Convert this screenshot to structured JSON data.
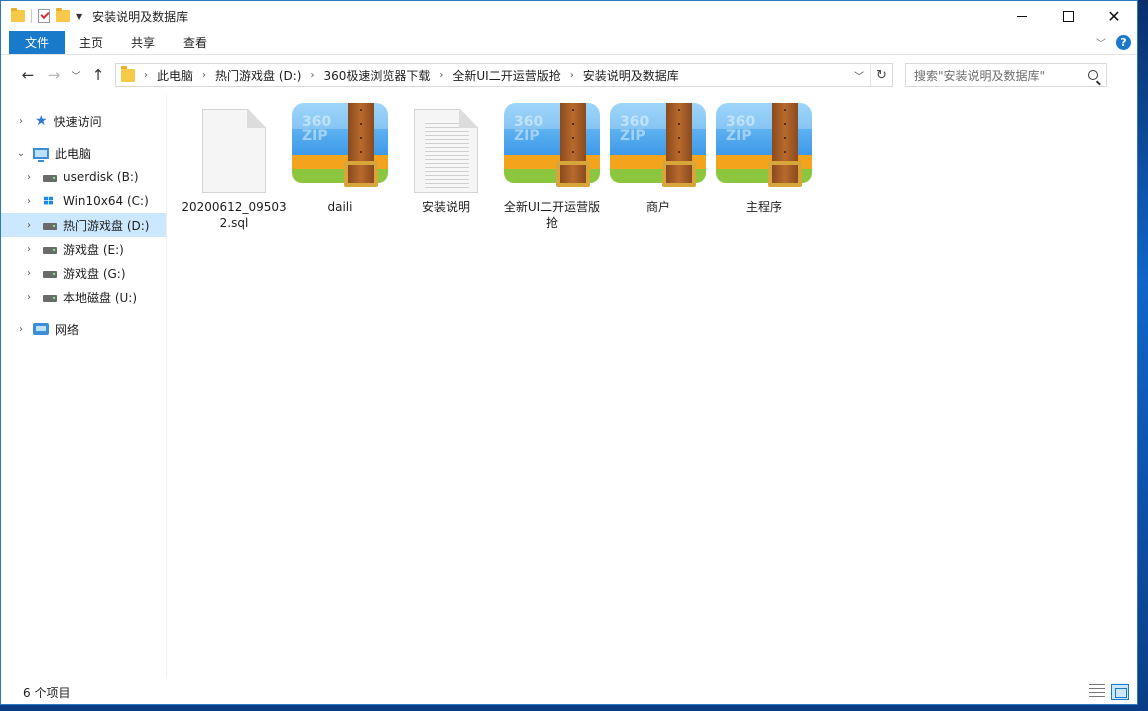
{
  "window": {
    "title": "安装说明及数据库"
  },
  "ribbon": {
    "tabs": [
      "文件",
      "主页",
      "共享",
      "查看"
    ],
    "help": "?"
  },
  "address": {
    "crumbs": [
      "此电脑",
      "热门游戏盘 (D:)",
      "360极速浏览器下载",
      "全新UI二开运营版抢",
      "安装说明及数据库"
    ]
  },
  "search": {
    "placeholder": "搜索\"安装说明及数据库\""
  },
  "navpane": {
    "quick_access": "快速访问",
    "this_pc": "此电脑",
    "drives": [
      {
        "label": "userdisk (B:)"
      },
      {
        "label": "Win10x64 (C:)"
      },
      {
        "label": "热门游戏盘 (D:)"
      },
      {
        "label": "游戏盘 (E:)"
      },
      {
        "label": "游戏盘 (G:)"
      },
      {
        "label": "本地磁盘 (U:)"
      }
    ],
    "network": "网络"
  },
  "files": [
    {
      "name": "20200612_095032.sql",
      "type": "sql-file"
    },
    {
      "name": "daili",
      "type": "zip-archive"
    },
    {
      "name": "安装说明",
      "type": "text-file"
    },
    {
      "name": "全新UI二开运营版抢",
      "type": "zip-archive"
    },
    {
      "name": "商户",
      "type": "zip-archive"
    },
    {
      "name": "主程序",
      "type": "zip-archive"
    }
  ],
  "zip_icon_text": [
    "360",
    "ZIP"
  ],
  "status": {
    "item_count": "6 个项目"
  }
}
